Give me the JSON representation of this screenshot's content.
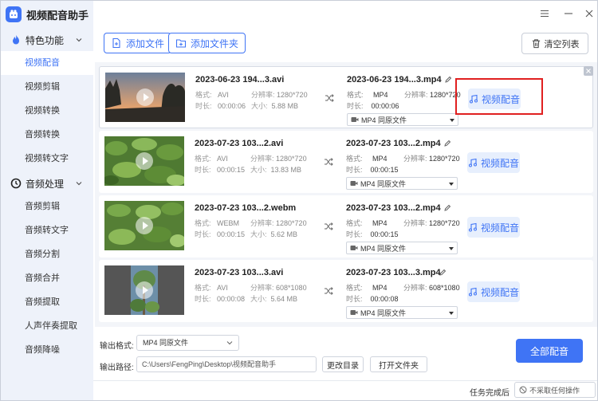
{
  "app": {
    "title": "视频配音助手"
  },
  "sidebar": {
    "groups": [
      {
        "label": "特色功能",
        "icon": "flame-icon",
        "items": [
          "视频配音",
          "视频剪辑",
          "视频转换",
          "音频转换",
          "视频转文字"
        ]
      },
      {
        "label": "音频处理",
        "icon": "clock-icon",
        "items": [
          "音频剪辑",
          "音频转文字",
          "音频分割",
          "音频合并",
          "音频提取",
          "人声伴奏提取",
          "音频降噪"
        ]
      }
    ],
    "active_item": "视频配音"
  },
  "toolbar": {
    "add_file": "添加文件",
    "add_folder": "添加文件夹",
    "clear_list": "清空列表"
  },
  "labels": {
    "format": "格式:",
    "resolution": "分辨率:",
    "duration": "时长:",
    "size": "大小:",
    "dub": "视频配音"
  },
  "files": [
    {
      "src_name": "2023-06-23 194...3.avi",
      "src_format": "AVI",
      "src_res": "1280*720",
      "src_dur": "00:00:06",
      "src_size": "5.88 MB",
      "out_name": "2023-06-23 194...3.mp4",
      "out_format": "MP4",
      "out_res": "1280*720",
      "out_dur": "00:00:06",
      "out_select": "MP4  同原文件"
    },
    {
      "src_name": "2023-07-23 103...2.avi",
      "src_format": "AVI",
      "src_res": "1280*720",
      "src_dur": "00:00:15",
      "src_size": "13.83 MB",
      "out_name": "2023-07-23 103...2.mp4",
      "out_format": "MP4",
      "out_res": "1280*720",
      "out_dur": "00:00:15",
      "out_select": "MP4  同原文件"
    },
    {
      "src_name": "2023-07-23 103...2.webm",
      "src_format": "WEBM",
      "src_res": "1280*720",
      "src_dur": "00:00:15",
      "src_size": "5.62 MB",
      "out_name": "2023-07-23 103...2.mp4",
      "out_format": "MP4",
      "out_res": "1280*720",
      "out_dur": "00:00:15",
      "out_select": "MP4  同原文件"
    },
    {
      "src_name": "2023-07-23 103...3.avi",
      "src_format": "AVI",
      "src_res": "608*1080",
      "src_dur": "00:00:08",
      "src_size": "5.64 MB",
      "out_name": "2023-07-23 103...3.mp4",
      "out_format": "MP4",
      "out_res": "608*1080",
      "out_dur": "00:00:08",
      "out_select": "MP4  同原文件"
    }
  ],
  "bottom": {
    "output_format_label": "输出格式:",
    "output_format_value": "MP4  同原文件",
    "output_path_label": "输出路径:",
    "output_path_value": "C:\\Users\\FengPing\\Desktop\\视频配音助手",
    "change_dir": "更改目录",
    "open_folder": "打开文件夹",
    "dub_all": "全部配音",
    "after_label": "任务完成后",
    "after_value": "不采取任何操作"
  },
  "colors": {
    "accent": "#3f74f5",
    "sidebar_bg": "#eef2fa",
    "highlight": "#e02020"
  }
}
